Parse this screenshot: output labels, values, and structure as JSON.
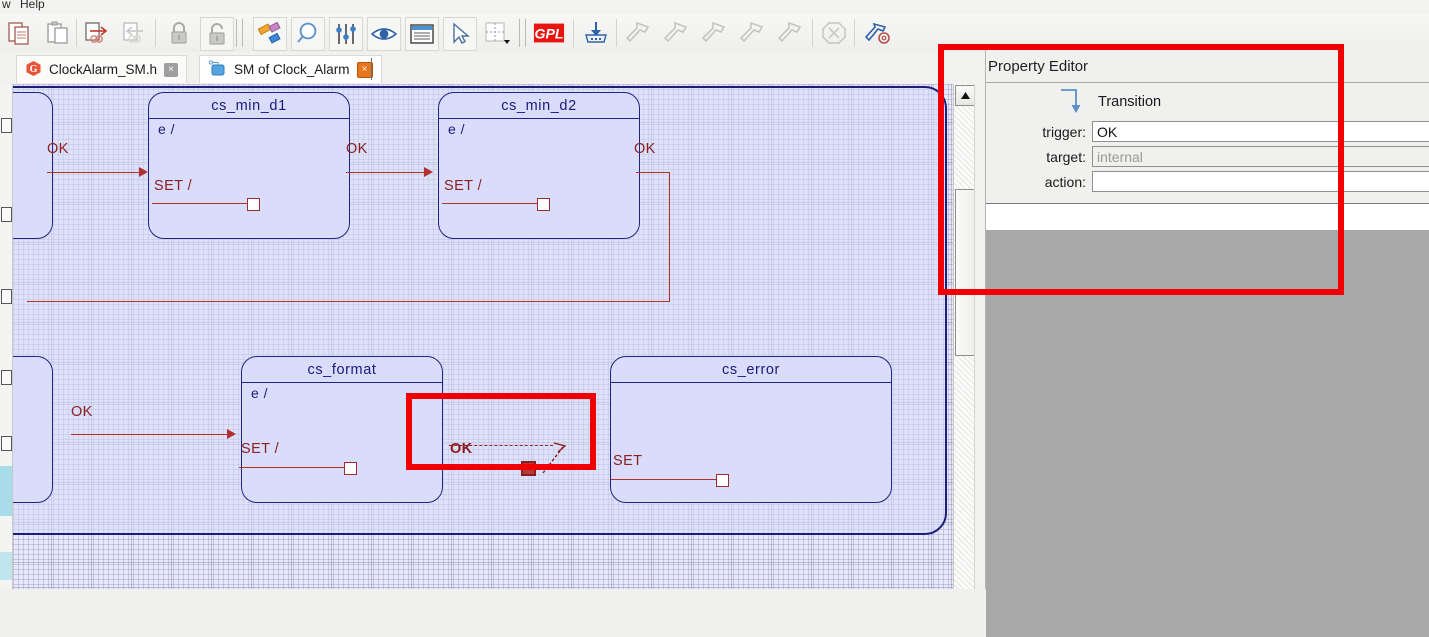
{
  "menubar": {
    "items": [
      {
        "label": "w"
      },
      {
        "label": "Help"
      }
    ]
  },
  "toolbar": {
    "buttons": [
      {
        "name": "copy-icon",
        "title": "Copy"
      },
      {
        "name": "paste-icon",
        "title": "Paste"
      },
      {
        "name": "export-link-icon",
        "title": "Export link"
      },
      {
        "name": "import-link-icon",
        "title": "Import link"
      },
      {
        "name": "lock-closed-icon",
        "title": "Lock"
      },
      {
        "name": "lock-open-icon",
        "title": "Unlock"
      },
      {
        "name": "shapes-icon",
        "title": "Shapes"
      },
      {
        "name": "zoom-icon",
        "title": "Zoom"
      },
      {
        "name": "sliders-icon",
        "title": "Settings"
      },
      {
        "name": "eye-icon",
        "title": "Show"
      },
      {
        "name": "document-icon",
        "title": "Document"
      },
      {
        "name": "cursor-icon",
        "title": "Select"
      },
      {
        "name": "grid-icon",
        "title": "Grid"
      },
      {
        "name": "gpl-icon",
        "title": "GPL",
        "label": "GPL"
      },
      {
        "name": "download-icon",
        "title": "Download"
      },
      {
        "name": "hammer-icon-1",
        "title": "Build"
      },
      {
        "name": "hammer-icon-2",
        "title": "Build"
      },
      {
        "name": "hammer-icon-3",
        "title": "Build"
      },
      {
        "name": "hammer-icon-4",
        "title": "Build"
      },
      {
        "name": "hammer-icon-5",
        "title": "Build"
      },
      {
        "name": "stop-icon",
        "title": "Stop"
      },
      {
        "name": "build-config-icon",
        "title": "Build configuration"
      }
    ]
  },
  "tabs": [
    {
      "label": "ClockAlarm_SM.h",
      "icon": "c-file-icon",
      "active": false,
      "close": "×"
    },
    {
      "label": "SM of Clock_Alarm",
      "icon": "state-machine-icon",
      "active": true,
      "close": "×"
    }
  ],
  "diagram": {
    "states": [
      {
        "name": "cs_min_d1",
        "entry": "e /",
        "action_label": "SET /"
      },
      {
        "name": "cs_min_d2",
        "entry": "e /",
        "action_label": "SET /"
      },
      {
        "name": "cs_format",
        "entry": "e /",
        "action_label": "SET /"
      },
      {
        "name": "cs_error",
        "entry": "",
        "action_label": "SET"
      }
    ],
    "transitions": [
      {
        "label": "OK",
        "from": "left-edge",
        "to": "cs_min_d1"
      },
      {
        "label": "OK",
        "from": "cs_min_d1",
        "to": "cs_min_d2"
      },
      {
        "label": "OK",
        "from": "cs_min_d2",
        "to": "row-below"
      },
      {
        "label": "OK",
        "from": "left-edge",
        "to": "cs_format"
      },
      {
        "label": "OK",
        "from": "cs_format",
        "to": "internal",
        "selected": true
      }
    ]
  },
  "scrollbar": {
    "up_arrow": "▲"
  },
  "property_editor": {
    "title": "Property Editor",
    "element_type": "Transition",
    "fields": [
      {
        "label": "trigger:",
        "value": "OK",
        "placeholder": "",
        "dim": false
      },
      {
        "label": "target:",
        "value": "",
        "placeholder": "internal",
        "dim": true
      },
      {
        "label": "action:",
        "value": "",
        "placeholder": "",
        "dim": false
      }
    ]
  },
  "colors": {
    "highlight_red": "#f00000",
    "state_border": "#23237f",
    "state_fill": "#d9ddfb",
    "transition_red": "#b13030",
    "canvas_bg": "#e7e9fa"
  }
}
